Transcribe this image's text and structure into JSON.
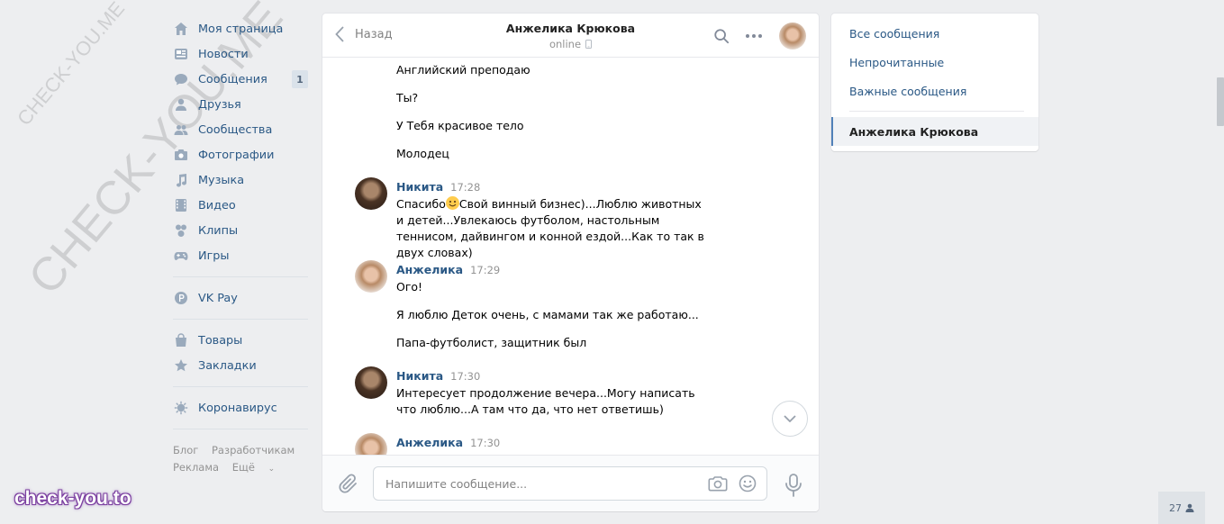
{
  "watermark": {
    "small": "CHECK-YOU.ME",
    "large": "CHECK-YOU.ME",
    "brand": "check-you.to"
  },
  "nav": {
    "items": [
      {
        "label": "Моя страница",
        "icon": "home-icon"
      },
      {
        "label": "Новости",
        "icon": "news-icon"
      },
      {
        "label": "Сообщения",
        "icon": "messages-icon",
        "badge": "1"
      },
      {
        "label": "Друзья",
        "icon": "friends-icon"
      },
      {
        "label": "Сообщества",
        "icon": "communities-icon"
      },
      {
        "label": "Фотографии",
        "icon": "photos-icon"
      },
      {
        "label": "Музыка",
        "icon": "music-icon"
      },
      {
        "label": "Видео",
        "icon": "video-icon"
      },
      {
        "label": "Клипы",
        "icon": "clips-icon"
      },
      {
        "label": "Игры",
        "icon": "games-icon"
      }
    ],
    "vkpay": "VK Pay",
    "goods": "Товары",
    "bookmarks": "Закладки",
    "corona": "Коронавирус",
    "footer": {
      "blog": "Блог",
      "dev": "Разработчикам",
      "ads": "Реклама",
      "more": "Ещё"
    }
  },
  "chat": {
    "back": "Назад",
    "peer_name": "Анжелика Крюкова",
    "peer_status": "online",
    "input_placeholder": "Напишите сообщение...",
    "messages": {
      "g1": {
        "lines": [
          "Английский преподаю",
          "Ты?",
          "У Тебя красивое тело",
          "Молодец"
        ]
      },
      "g2": {
        "author": "Никита",
        "time": "17:28",
        "text_before_emoji": "Спасибо",
        "text_after_emoji": "Свой винный бизнес)...Люблю животных и детей...Увлекаюсь футболом, настольным теннисом, дайвингом и конной ездой...Как то так в двух словах)"
      },
      "g3": {
        "author": "Анжелика",
        "time": "17:29",
        "lines": [
          "Ого!",
          "Я люблю Деток очень, с мамами так же работаю...",
          "Папа-футболист, защитник был"
        ]
      },
      "g4": {
        "author": "Никита",
        "time": "17:30",
        "text": "Интересует продолжение вечера...Могу написать что люблю...А там что да, что нет ответишь)"
      },
      "g5": {
        "author": "Анжелика",
        "time": "17:30"
      }
    }
  },
  "right": {
    "all": "Все сообщения",
    "unread": "Непрочитанные",
    "important": "Важные сообщения",
    "active": "Анжелика Крюкова"
  },
  "counter": {
    "count": "27"
  },
  "colors": {
    "link": "#2a5885",
    "background": "#edeef0",
    "accent": "#5181b8"
  }
}
